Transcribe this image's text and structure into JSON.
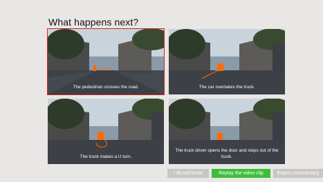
{
  "prompt": {
    "question": "What happens next?"
  },
  "options": [
    {
      "caption": "The pedestrian crosses the road."
    },
    {
      "caption": "The car overtakes the truck."
    },
    {
      "caption": "The truck makes a U turn."
    },
    {
      "caption": "The truck driver opens the door and steps out of the truck."
    }
  ],
  "buttons": {
    "dont_know": "I do not know",
    "replay": "Replay the video clip",
    "expert": "Expert commentary"
  },
  "colors": {
    "selected_outline": "#d6241f",
    "marker": "#ff6a00",
    "replay_button": "#3cbf3a"
  },
  "selected_option": 0
}
